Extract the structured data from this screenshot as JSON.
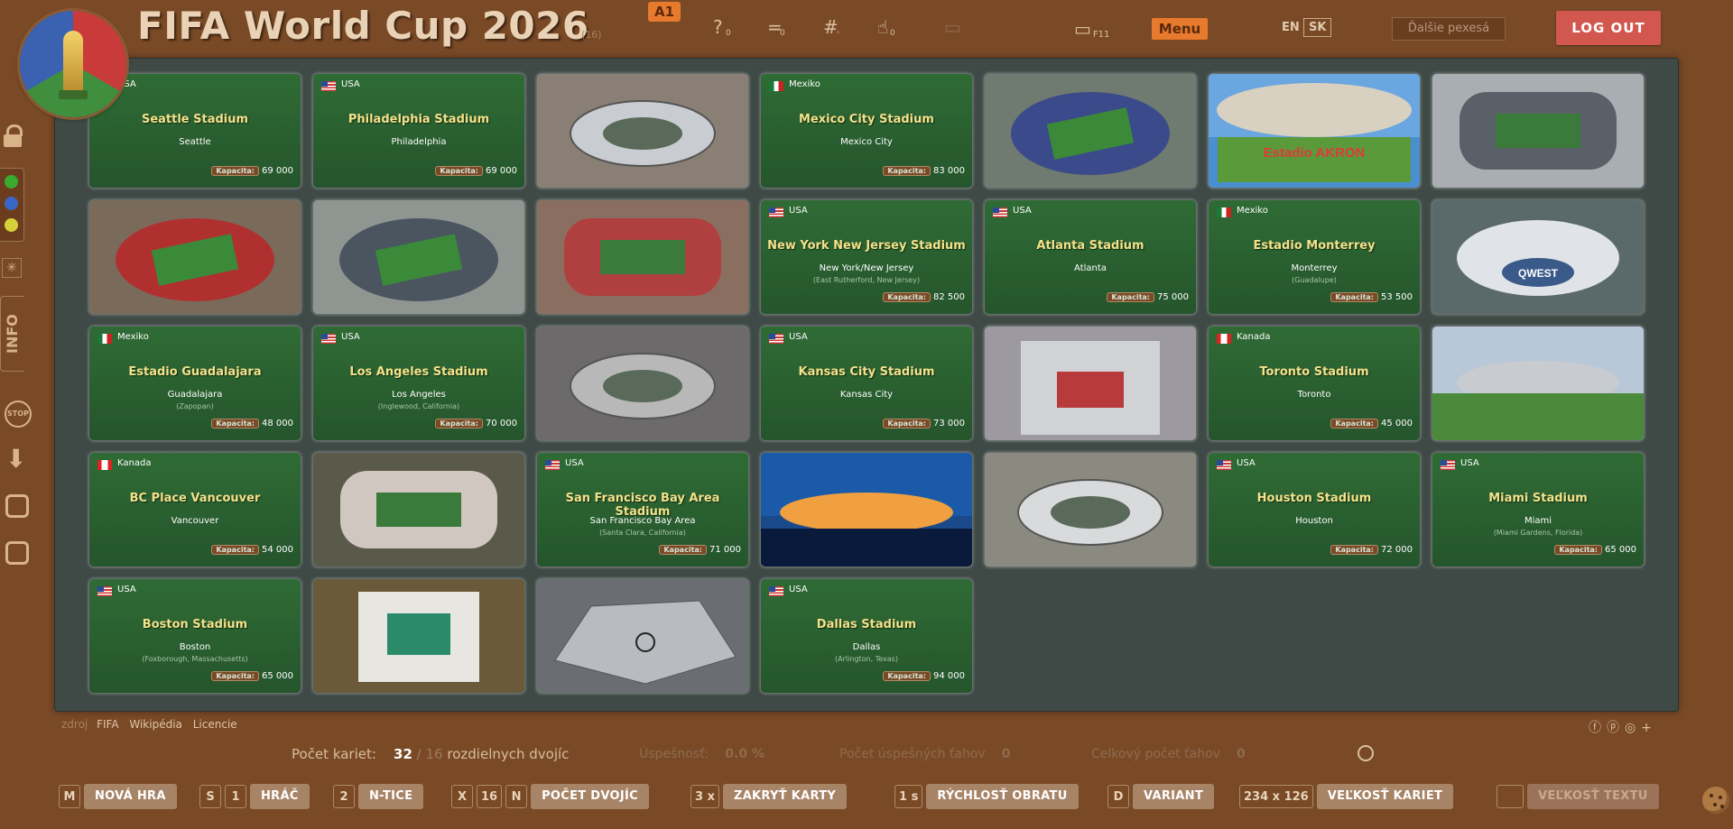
{
  "header": {
    "title": "FIFA World Cup 2026",
    "title_count": "(16)",
    "badge": "A1",
    "icon_counts": [
      "0",
      "0",
      "0"
    ],
    "f11_label": "F11",
    "menu_label": "Menu",
    "lang_en": "EN",
    "lang_sk": "SK",
    "more_games": "Ďalšie pexesá",
    "logout": "LOG OUT"
  },
  "sidebar": {
    "info_label": "INFO",
    "stop_label": "STOP",
    "dot_colors": [
      "#3aaa2e",
      "#3a66c8",
      "#d8d23a"
    ]
  },
  "board": {
    "cap_label": "Kapacita:",
    "cards": [
      {
        "type": "info",
        "flag": "usa",
        "country": "USA",
        "name": "Seattle Stadium",
        "city": "Seattle",
        "sub": "",
        "capacity": "69 000"
      },
      {
        "type": "info",
        "flag": "usa",
        "country": "USA",
        "name": "Philadelphia Stadium",
        "city": "Philadelphia",
        "sub": "",
        "capacity": "69 000"
      },
      {
        "type": "photo",
        "subject": "sofi-stadium-photo"
      },
      {
        "type": "info",
        "flag": "mex",
        "country": "Mexiko",
        "name": "Mexico City Stadium",
        "city": "Mexico City",
        "sub": "",
        "capacity": "83 000"
      },
      {
        "type": "photo",
        "subject": "gillette-stadium-photo"
      },
      {
        "type": "photo",
        "subject": "estadio-akron-photo",
        "sign": "Estadio AKRON"
      },
      {
        "type": "photo",
        "subject": "lincoln-financial-field-photo"
      },
      {
        "type": "photo",
        "subject": "arrowhead-stadium-photo"
      },
      {
        "type": "photo",
        "subject": "metlife-stadium-photo"
      },
      {
        "type": "photo",
        "subject": "levis-stadium-photo"
      },
      {
        "type": "info",
        "flag": "usa",
        "country": "USA",
        "name": "New York New Jersey Stadium",
        "city": "New York/New Jersey",
        "sub": "(East Rutherford, New Jersey)",
        "capacity": "82 500"
      },
      {
        "type": "info",
        "flag": "usa",
        "country": "USA",
        "name": "Atlanta Stadium",
        "city": "Atlanta",
        "sub": "",
        "capacity": "75 000"
      },
      {
        "type": "info",
        "flag": "mex",
        "country": "Mexiko",
        "name": "Estadio Monterrey",
        "city": "Monterrey",
        "sub": "(Guadalupe)",
        "capacity": "53 500"
      },
      {
        "type": "photo",
        "subject": "lumen-field-photo",
        "sign": "QWEST"
      },
      {
        "type": "info",
        "flag": "mex",
        "country": "Mexiko",
        "name": "Estadio Guadalajara",
        "city": "Guadalajara",
        "sub": "(Zapopan)",
        "capacity": "48 000"
      },
      {
        "type": "info",
        "flag": "usa",
        "country": "USA",
        "name": "Los Angeles Stadium",
        "city": "Los Angeles",
        "sub": "(Inglewood, California)",
        "capacity": "70 000"
      },
      {
        "type": "photo",
        "subject": "estadio-azteca-photo"
      },
      {
        "type": "info",
        "flag": "usa",
        "country": "USA",
        "name": "Kansas City Stadium",
        "city": "Kansas City",
        "sub": "",
        "capacity": "73 000"
      },
      {
        "type": "photo",
        "subject": "nrg-stadium-photo"
      },
      {
        "type": "info",
        "flag": "can",
        "country": "Kanada",
        "name": "Toronto Stadium",
        "city": "Toronto",
        "sub": "",
        "capacity": "45 000"
      },
      {
        "type": "photo",
        "subject": "att-stadium-photo"
      },
      {
        "type": "info",
        "flag": "can",
        "country": "Kanada",
        "name": "BC Place Vancouver",
        "city": "Vancouver",
        "sub": "",
        "capacity": "54 000"
      },
      {
        "type": "photo",
        "subject": "bmo-field-photo"
      },
      {
        "type": "info",
        "flag": "usa",
        "country": "USA",
        "name": "San Francisco Bay Area Stadium",
        "city": "San Francisco Bay Area",
        "sub": "(Santa Clara, California)",
        "capacity": "71 000"
      },
      {
        "type": "photo",
        "subject": "bc-place-night-photo"
      },
      {
        "type": "photo",
        "subject": "estadio-bbva-photo"
      },
      {
        "type": "info",
        "flag": "usa",
        "country": "USA",
        "name": "Houston Stadium",
        "city": "Houston",
        "sub": "",
        "capacity": "72 000"
      },
      {
        "type": "info",
        "flag": "usa",
        "country": "USA",
        "name": "Miami Stadium",
        "city": "Miami",
        "sub": "(Miami Gardens, Florida)",
        "capacity": "65 000"
      },
      {
        "type": "info",
        "flag": "usa",
        "country": "USA",
        "name": "Boston Stadium",
        "city": "Boston",
        "sub": "(Foxborough, Massachusetts)",
        "capacity": "65 000"
      },
      {
        "type": "photo",
        "subject": "hard-rock-stadium-photo"
      },
      {
        "type": "photo",
        "subject": "mercedes-benz-stadium-photo"
      },
      {
        "type": "info",
        "flag": "usa",
        "country": "USA",
        "name": "Dallas Stadium",
        "city": "Dallas",
        "sub": "(Arlington, Texas)",
        "capacity": "94 000"
      }
    ]
  },
  "footer": {
    "source_label": "zdroj",
    "links": [
      "FIFA",
      "Wikipédia",
      "Licencie"
    ],
    "cards_label": "Počet kariet:",
    "cards_total": "32",
    "pairs": "16",
    "pairs_label": "rozdielnych dvojíc",
    "success_label": "Úspešnosť:",
    "success_value": "0.0 %",
    "good_moves_label": "Počet úspešných ťahov",
    "good_moves": "0",
    "total_moves_label": "Celkový počet ťahov",
    "total_moves": "0"
  },
  "controls": {
    "new_game": {
      "key": "M",
      "label": "NOVÁ HRA"
    },
    "player": {
      "key": "S",
      "value": "1",
      "label": "HRÁČ"
    },
    "ntice": {
      "value": "2",
      "label": "N-TICE"
    },
    "pairs": {
      "key_x": "X",
      "value": "16",
      "key_n": "N",
      "label": "POČET DVOJÍC"
    },
    "cover": {
      "value": "3 x",
      "label": "ZAKRYŤ KARTY"
    },
    "speed": {
      "value": "1 s",
      "label": "RÝCHLOSŤ OBRATU"
    },
    "variant": {
      "key": "D",
      "label": "VARIANT"
    },
    "size": {
      "value": "234 x 126",
      "label": "VEĽKOSŤ KARIET"
    },
    "text_size": {
      "label": "VEĽKOSŤ TEXTU"
    }
  }
}
